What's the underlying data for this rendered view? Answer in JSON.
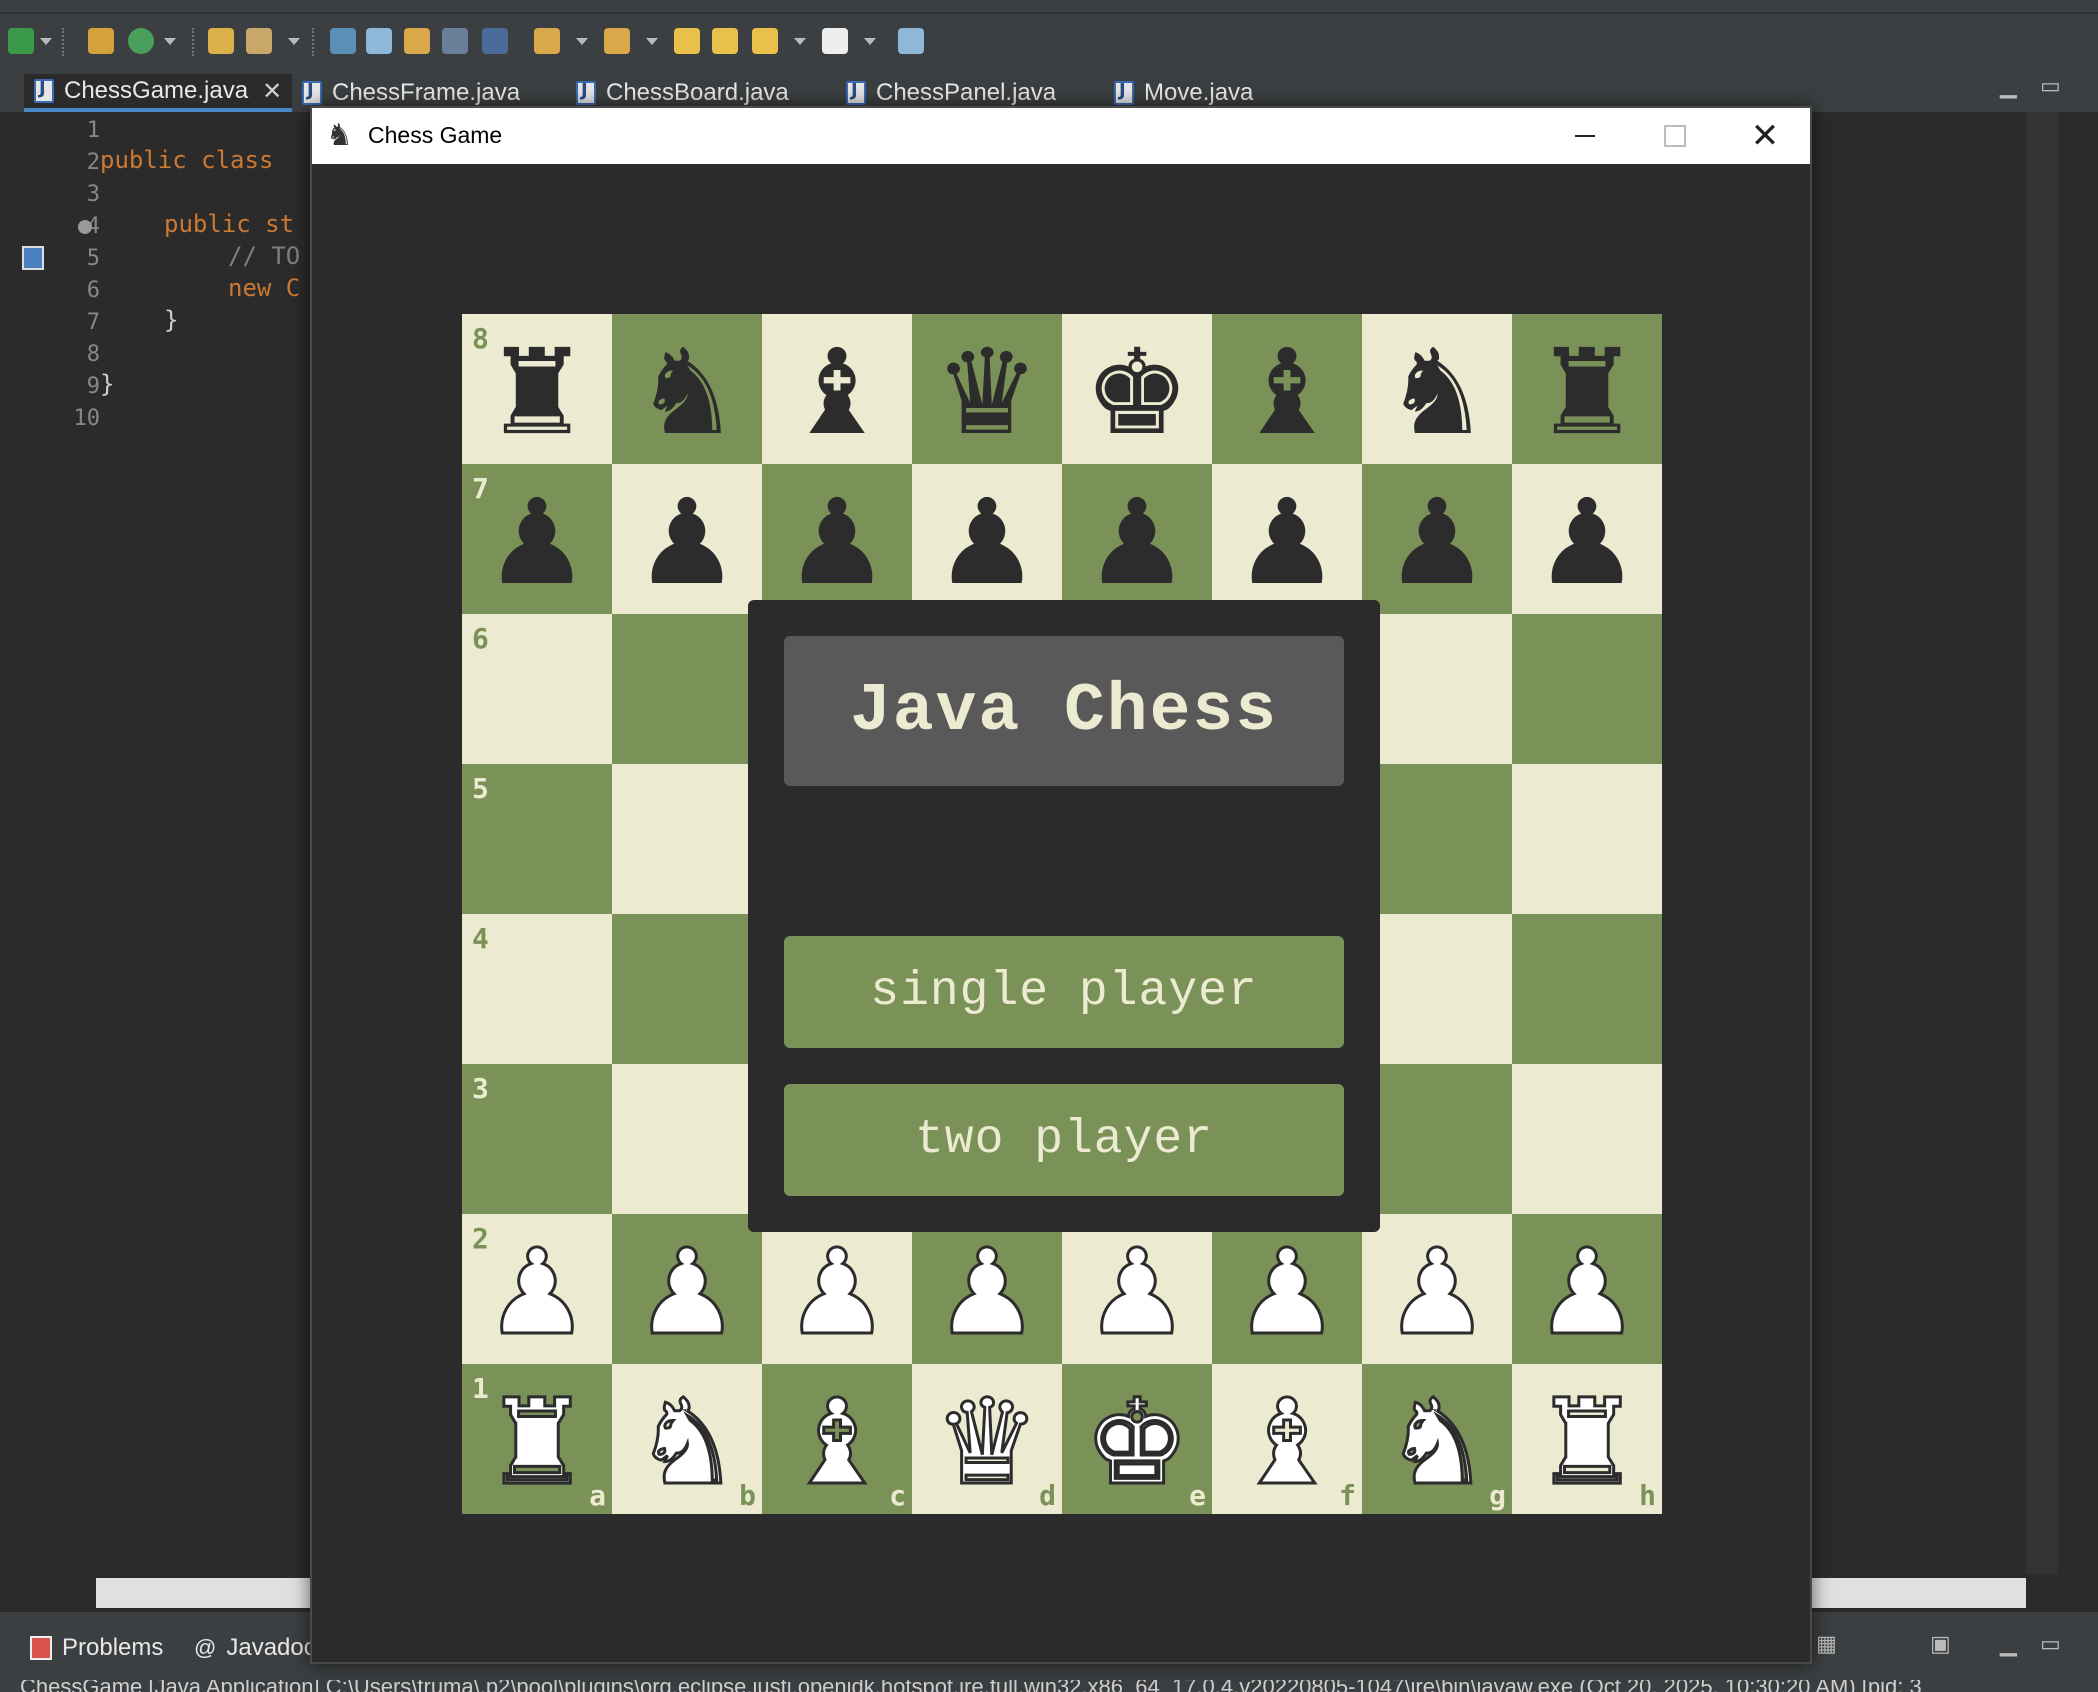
{
  "colors": {
    "light_square": "#ecebd1",
    "dark_square": "#7a9157",
    "background": "#2b2b2b",
    "title_box": "#595959"
  },
  "ide": {
    "editor_tabs": [
      {
        "label": "ChessGame.java"
      },
      {
        "label": "ChessFrame.java"
      },
      {
        "label": "ChessBoard.java"
      },
      {
        "label": "ChessPanel.java"
      },
      {
        "label": "Move.java"
      }
    ],
    "line_numbers": [
      "1",
      "2",
      "3",
      "4",
      "5",
      "6",
      "7",
      "8",
      "9",
      "10"
    ],
    "code_lines": {
      "l2": "public class",
      "l4": "public st",
      "l5": "// TO",
      "l6": "new C",
      "l7": "}",
      "l9": "}"
    },
    "bottom_tabs": {
      "problems": "Problems",
      "javadoc": "Javadoc"
    },
    "status_text": "ChessGame [Java Application] C:\\Users\\truma\\.p2\\pool\\plugins\\org.eclipse.justj.openjdk.hotspot.jre.full.win32.x86_64_17.0.4.v20220805-1047\\jre\\bin\\javaw.exe  (Oct 20, 2025, 10:30:20 AM) [pid: 3"
  },
  "window": {
    "title": "Chess Game",
    "minimize": "minimize",
    "maximize": "maximize",
    "close": "✕"
  },
  "board": {
    "rank_labels": [
      "8",
      "7",
      "6",
      "5",
      "4",
      "3",
      "2",
      "1"
    ],
    "file_labels": [
      "a",
      "b",
      "c",
      "d",
      "e",
      "f",
      "g",
      "h"
    ],
    "pieces": [
      [
        "br",
        "bn",
        "bb",
        "bq",
        "bk",
        "bb",
        "bn",
        "br"
      ],
      [
        "bp",
        "bp",
        "bp",
        "bp",
        "bp",
        "bp",
        "bp",
        "bp"
      ],
      [
        "",
        "",
        "",
        "",
        "",
        "",
        "",
        ""
      ],
      [
        "",
        "",
        "",
        "",
        "",
        "",
        "",
        ""
      ],
      [
        "",
        "",
        "",
        "",
        "",
        "",
        "",
        ""
      ],
      [
        "",
        "",
        "",
        "",
        "",
        "",
        "",
        ""
      ],
      [
        "wp",
        "wp",
        "wp",
        "wp",
        "wp",
        "wp",
        "wp",
        "wp"
      ],
      [
        "wr",
        "wn",
        "wb",
        "wq",
        "wk",
        "wb",
        "wn",
        "wr"
      ]
    ]
  },
  "menu": {
    "title": "Java Chess",
    "single_player": "single player",
    "two_player": "two player"
  }
}
